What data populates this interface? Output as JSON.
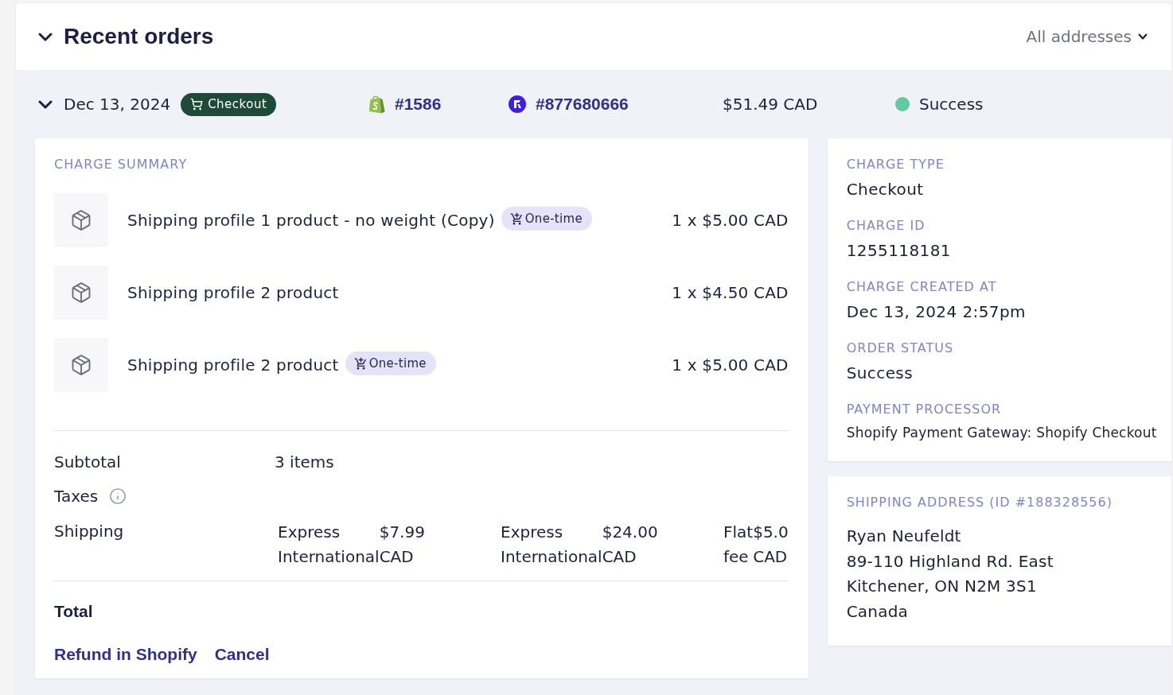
{
  "header": {
    "title": "Recent orders",
    "expanded": true,
    "filter": "All addresses"
  },
  "orders": [
    {
      "expanded": true,
      "date": "Dec 13, 2024",
      "charge_type_badge": "Checkout",
      "shopify_order": "#1586",
      "recharge_order": "#877680666",
      "amount": "$51.49 CAD",
      "status": {
        "label": "Success",
        "color": "#5fcb9e"
      },
      "charge_summary": {
        "title": "CHARGE SUMMARY",
        "items": [
          {
            "name": "Shipping profile 1 product - no weight (Copy)",
            "badge": "One-time",
            "price": "1 x $5.00 CAD"
          },
          {
            "name": "Shipping profile 2 product",
            "price": "1 x $4.50 CAD"
          },
          {
            "name": "Shipping profile 2 product",
            "badge": "One-time",
            "price": "1 x $5.00 CAD"
          }
        ],
        "subtotal": {
          "label": "Subtotal",
          "value": "3 items"
        },
        "taxes": {
          "label": "Taxes"
        },
        "shipping": {
          "label": "Shipping",
          "lines": [
            {
              "name": "Express International",
              "price": "$7.99 CAD"
            },
            {
              "name": "Express International",
              "price": "$24.00 CAD"
            },
            {
              "name": "Flat fee",
              "price": "$5.0 CAD"
            }
          ]
        },
        "total": {
          "label": "Total"
        },
        "actions": [
          "Refund in Shopify",
          "Cancel"
        ]
      },
      "details": [
        {
          "kind": "regular",
          "label": "CHARGE TYPE",
          "value": "Checkout"
        },
        {
          "kind": "regular",
          "label": "CHARGE ID",
          "value": "1255118181"
        },
        {
          "kind": "regular",
          "label": "CHARGE CREATED AT",
          "value": "Dec 13, 2024 2:57pm"
        },
        {
          "kind": "regular",
          "label": "ORDER STATUS",
          "value": "Success"
        },
        {
          "kind": "compact",
          "label": "PAYMENT PROCESSOR",
          "value": "Shopify Payment Gateway: Shopify Checkout"
        }
      ],
      "shipping_address": {
        "title": "SHIPPING ADDRESS (ID #188328556)",
        "lines": [
          "Ryan Neufeldt",
          "89-110 Highland Rd. East",
          "Kitchener, ON N2M 3S1",
          "Canada"
        ]
      }
    }
  ]
}
